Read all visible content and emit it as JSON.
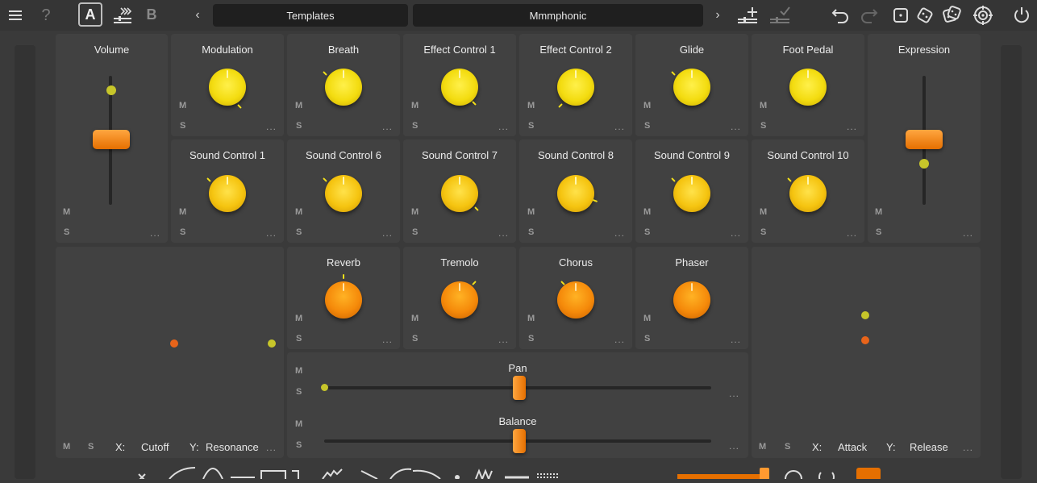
{
  "topbar": {
    "a_label": "A",
    "b_label": "B",
    "preset_category": "Templates",
    "preset_name": "Mmmphonic",
    "icons": [
      "menu-icon",
      "help-icon",
      "copy-a-to-b-icon",
      "prev-arrow-icon",
      "next-arrow-icon",
      "add-controller-icon",
      "confirm-icon",
      "undo-icon",
      "redo-icon",
      "dice-1-icon",
      "dice-2-icon",
      "dice-3-icon",
      "target-icon",
      "power-icon"
    ]
  },
  "labels": {
    "mute": "M",
    "solo": "S",
    "more": "..."
  },
  "row1": [
    {
      "title": "Volume"
    },
    {
      "title": "Modulation"
    },
    {
      "title": "Breath"
    },
    {
      "title": "Effect Control 1"
    },
    {
      "title": "Effect Control 2"
    },
    {
      "title": "Glide"
    },
    {
      "title": "Foot Pedal"
    },
    {
      "title": "Expression"
    }
  ],
  "row2": [
    {
      "title": "Sound Control 1"
    },
    {
      "title": "Sound Control 6"
    },
    {
      "title": "Sound Control 7"
    },
    {
      "title": "Sound Control 8"
    },
    {
      "title": "Sound Control 9"
    },
    {
      "title": "Sound Control 10"
    }
  ],
  "row3": [
    {
      "title": "Reverb"
    },
    {
      "title": "Tremolo"
    },
    {
      "title": "Chorus"
    },
    {
      "title": "Phaser"
    }
  ],
  "sliders": {
    "pan": {
      "title": "Pan"
    },
    "balance": {
      "title": "Balance"
    }
  },
  "xy_left": {
    "x_label": "X:",
    "x_value": "Cutoff",
    "y_label": "Y:",
    "y_value": "Resonance"
  },
  "xy_right": {
    "x_label": "X:",
    "x_value": "Attack",
    "y_label": "Y:",
    "y_value": "Release"
  },
  "colors": {
    "yellow": "#f3dc10",
    "orange": "#f58a0a",
    "panel": "#414141",
    "background": "#3a3a3a"
  }
}
